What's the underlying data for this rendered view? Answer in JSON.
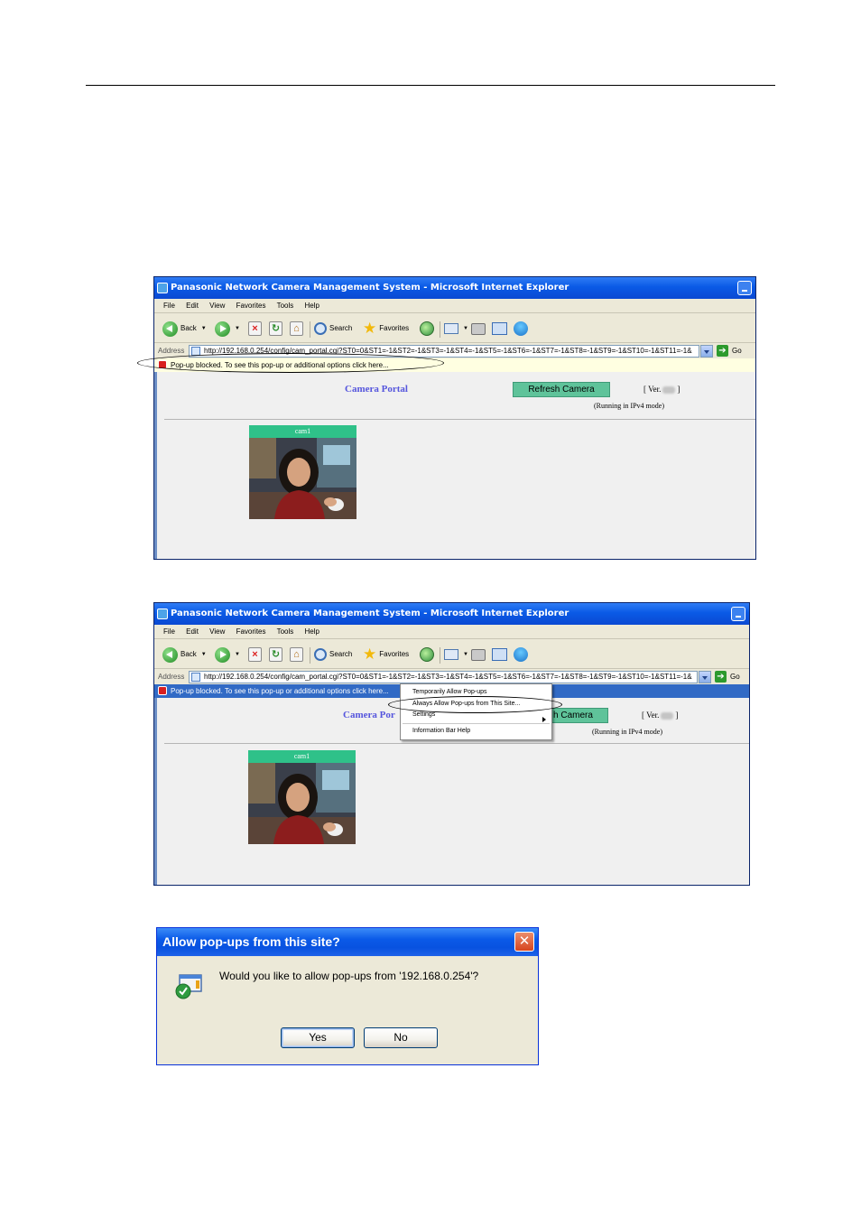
{
  "browser": {
    "title": "Panasonic Network Camera Management System - Microsoft Internet Explorer",
    "menu": [
      "File",
      "Edit",
      "View",
      "Favorites",
      "Tools",
      "Help"
    ],
    "toolbar": {
      "back": "Back",
      "search": "Search",
      "favorites": "Favorites"
    },
    "address_label": "Address",
    "address_url": "http://192.168.0.254/config/cam_portal.cgi?ST0=0&ST1=-1&ST2=-1&ST3=-1&ST4=-1&ST5=-1&ST6=-1&ST7=-1&ST8=-1&ST9=-1&ST10=-1&ST11=-1&",
    "go_label": "Go",
    "infobar_text": "Pop-up blocked. To see this pop-up or additional options click here..."
  },
  "portal": {
    "title": "Camera Portal",
    "refresh_button": "Refresh Camera",
    "version_prefix": "[ Ver.",
    "version_suffix": "]",
    "mode": "(Running in IPv4 mode)",
    "camera_name": "cam1",
    "partial_title": "Camera Por",
    "partial_button": "h Camera"
  },
  "context_menu": {
    "items": [
      "Temporarily Allow Pop-ups",
      "Always Allow Pop-ups from This Site...",
      "Settings",
      "Information Bar Help"
    ]
  },
  "dialog": {
    "title": "Allow pop-ups from this site?",
    "message": "Would you like to allow pop-ups from '192.168.0.254'?",
    "yes": "Yes",
    "no": "No"
  }
}
